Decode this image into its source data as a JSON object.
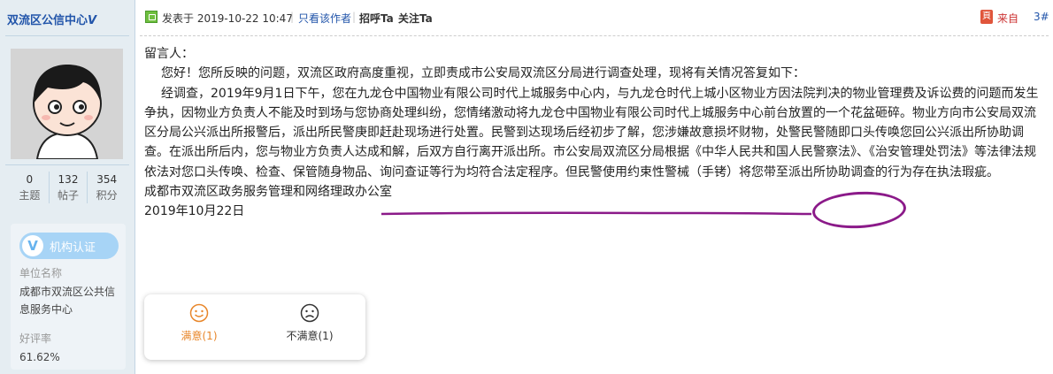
{
  "sidebar": {
    "username": "双流区公信中心",
    "username_badge": "V",
    "stats": [
      {
        "value": "0",
        "label": "主题"
      },
      {
        "value": "132",
        "label": "帖子"
      },
      {
        "value": "354",
        "label": "积分"
      }
    ],
    "cert_button": "机构认证",
    "cert_icon": "V",
    "unit_label": "单位名称",
    "unit_value": "成都市双流区公共信息服务中心",
    "rating_label": "好评率",
    "rating_value": "61.62%"
  },
  "header": {
    "posted": "发表于 2019-10-22 10:47",
    "author_only": "只看该作者",
    "greet": "招呼Ta",
    "follow": "关注Ta",
    "source_icon": "頁",
    "source": "来自",
    "floor": "3#"
  },
  "message": {
    "salutation": "留言人：",
    "para1": "您好！您所反映的问题，双流区政府高度重视，立即责成市公安局双流区分局进行调查处理，现将有关情况答复如下：",
    "para2": "经调查，2019年9月1日下午，您在九龙仓中国物业有限公司时代上城服务中心内，与九龙仓时代上城小区物业方因法院判决的物业管理费及诉讼费的问题而发生争执，因物业方负责人不能及时到场与您协商处理纠纷，您情绪激动将九龙仓中国物业有限公司时代上城服务中心前台放置的一个花盆砸碎。物业方向市公安局双流区分局公兴派出所报警后，派出所民警庚即赶赴现场进行处置。民警到达现场后经初步了解，您涉嫌故意损坏财物，处警民警随即口头传唤您回公兴派出所协助调查。在派出所后内，您与物业方负责人达成和解，后双方自行离开派出所。市公安局双流区分局根据《中华人民共和国人民警察法》、《治安管理处罚法》等法律法规依法对您口头传唤、检查、保管随身物品、询问查证等行为均符合法定程序。但民警使用约束性警械（手铐）将您带至派出所协助调查的行为存在执法瑕疵。",
    "signature": "成都市双流区政务服务管理和网络理政办公室",
    "date": "2019年10月22日"
  },
  "vote": {
    "satisfied": "满意(1)",
    "unsatisfied": "不满意(1)"
  },
  "colors": {
    "sidebar_bg": "#e5edf2",
    "link": "#2255aa",
    "annotation": "#8b1a89",
    "satisfied": "#e8862a"
  }
}
